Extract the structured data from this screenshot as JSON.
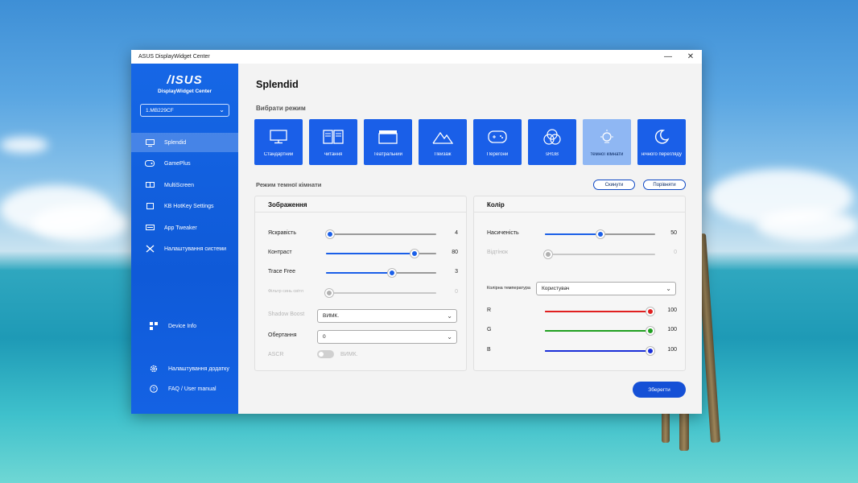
{
  "window": {
    "title": "ASUS DisplayWidget Center",
    "minimize": "—",
    "close": "✕"
  },
  "sidebar": {
    "brand": "/ISUS",
    "subtitle": "DisplayWidget Center",
    "monitor": "1.MB229CF",
    "items": [
      {
        "label": "Splendid",
        "icon": "splendid-icon"
      },
      {
        "label": "GamePlus",
        "icon": "gamepad-icon"
      },
      {
        "label": "MultiScreen",
        "icon": "multiscreen-icon"
      },
      {
        "label": "KB HotKey Settings",
        "icon": "keyboard-icon"
      },
      {
        "label": "App Tweaker",
        "icon": "app-tweaker-icon"
      },
      {
        "label": "Налаштування системи",
        "icon": "tools-icon"
      }
    ],
    "device_info": "Device Info",
    "app_settings": "Налаштування додатку",
    "faq": "FAQ / User manual"
  },
  "main": {
    "title": "Splendid",
    "mode_section_label": "Вибрати режим",
    "modes": [
      {
        "label": "Стандартний",
        "icon": "monitor-icon"
      },
      {
        "label": "читання",
        "icon": "book-icon"
      },
      {
        "label": "Театральний",
        "icon": "clapper-icon"
      },
      {
        "label": "Пейзаж",
        "icon": "mountain-icon"
      },
      {
        "label": "Перегони",
        "icon": "gamepad-icon"
      },
      {
        "label": "sRGB",
        "icon": "rgb-circles-icon"
      },
      {
        "label": "темної кімнати",
        "icon": "lamp-icon"
      },
      {
        "label": "нічного перегляду",
        "icon": "moon-icon"
      }
    ],
    "active_mode": "темної кімнати",
    "submode_label": "Режим темної кімнати",
    "reset_label": "Скинути",
    "compare_label": "Порівняти",
    "image_panel": {
      "title": "Зображення",
      "brightness": {
        "label": "Яскравість",
        "value": "4",
        "level": 0.04
      },
      "contrast": {
        "label": "Контраст",
        "value": "80",
        "level": 0.8
      },
      "trace_free": {
        "label": "Trace Free",
        "value": "3",
        "level": 0.6
      },
      "blue_light": {
        "label": "Фільтр синь світл",
        "value": "0",
        "level": 0.0
      },
      "shadow_boost": {
        "label": "Shadow Boost",
        "value": "ВИМК."
      },
      "rotation": {
        "label": "Обертання",
        "value": "0"
      },
      "ascr": {
        "label": "ASCR",
        "value": "ВИМК."
      }
    },
    "color_panel": {
      "title": "Колір",
      "saturation": {
        "label": "Насиченість",
        "value": "50",
        "level": 0.5
      },
      "hue": {
        "label": "Відтінок",
        "value": "0",
        "level": 0.0
      },
      "color_temp": {
        "label": "Колірна температура",
        "value": "Користувач"
      },
      "r": {
        "label": "R",
        "value": "100",
        "level": 1.0,
        "color": "#e02020"
      },
      "g": {
        "label": "G",
        "value": "100",
        "level": 1.0,
        "color": "#20a020"
      },
      "b": {
        "label": "B",
        "value": "100",
        "level": 1.0,
        "color": "#1a2fd8"
      }
    },
    "save_label": "Зберегти"
  }
}
